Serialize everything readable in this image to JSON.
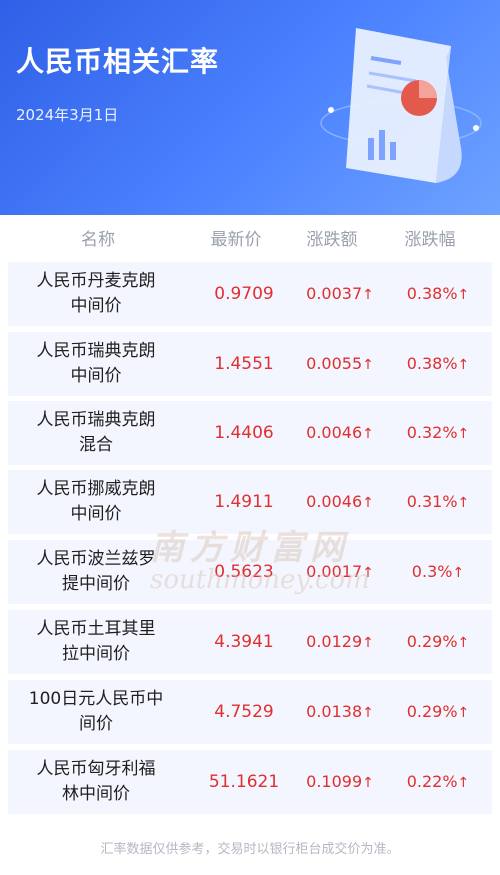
{
  "header": {
    "title": "人民币相关汇率",
    "date": "2024年3月1日"
  },
  "columns": [
    "名称",
    "最新价",
    "涨跌额",
    "涨跌幅"
  ],
  "arrow_symbol": "↑",
  "rows": [
    {
      "name_line1": "人民币丹麦克朗",
      "name_line2": "中间价",
      "price": "0.9709",
      "change": "0.0037",
      "pct": "0.38%"
    },
    {
      "name_line1": "人民币瑞典克朗",
      "name_line2": "中间价",
      "price": "1.4551",
      "change": "0.0055",
      "pct": "0.38%"
    },
    {
      "name_line1": "人民币瑞典克朗",
      "name_line2": "混合",
      "price": "1.4406",
      "change": "0.0046",
      "pct": "0.32%"
    },
    {
      "name_line1": "人民币挪威克朗",
      "name_line2": "中间价",
      "price": "1.4911",
      "change": "0.0046",
      "pct": "0.31%"
    },
    {
      "name_line1": "人民币波兰兹罗",
      "name_line2": "提中间价",
      "price": "0.5623",
      "change": "0.0017",
      "pct": "0.3%"
    },
    {
      "name_line1": "人民币土耳其里",
      "name_line2": "拉中间价",
      "price": "4.3941",
      "change": "0.0129",
      "pct": "0.29%"
    },
    {
      "name_line1": "100日元人民币中",
      "name_line2": "间价",
      "price": "4.7529",
      "change": "0.0138",
      "pct": "0.29%"
    },
    {
      "name_line1": "人民币匈牙利福",
      "name_line2": "林中间价",
      "price": "51.1621",
      "change": "0.1099",
      "pct": "0.22%"
    }
  ],
  "watermark": {
    "cn": "南方财富网",
    "en": "southmoney.com"
  },
  "footer": "汇率数据仅供参考，交易时以银行柜台成交价为准。",
  "colors": {
    "header_bg": "#3a6cf0",
    "up": "#e02f2f",
    "row_bg": "#f3f6fe",
    "header_text": "#9aa0ad"
  }
}
